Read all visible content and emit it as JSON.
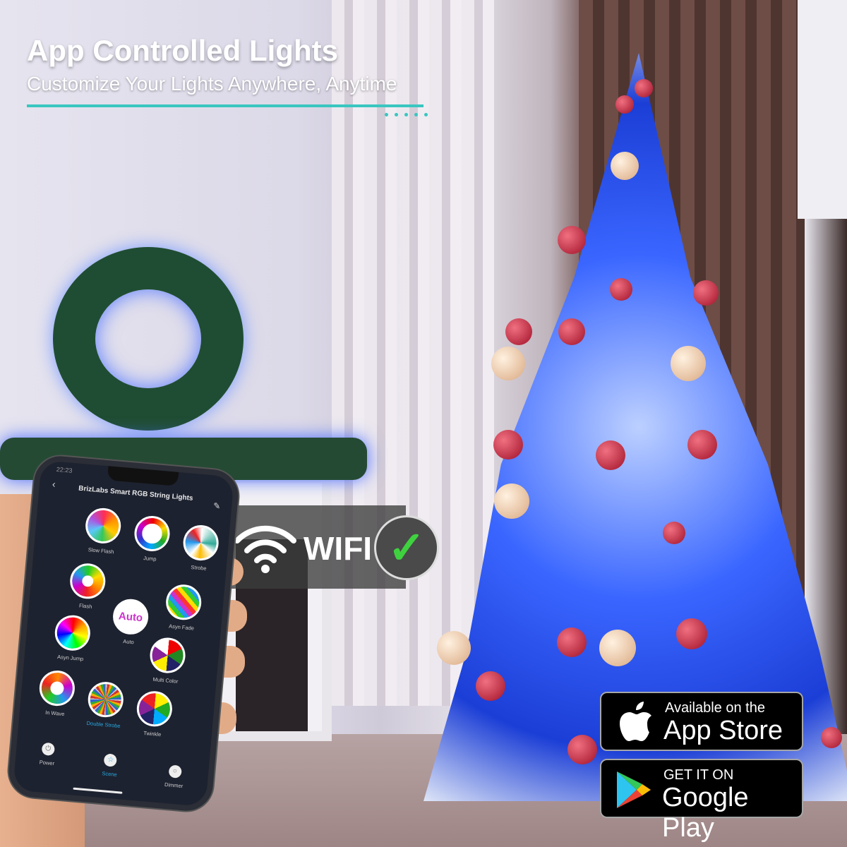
{
  "headline": {
    "title": "App Controlled Lights",
    "subtitle": "Customize Your Lights Anywhere, Anytime",
    "accent": "#39c6c0"
  },
  "wifi_badge": {
    "label": "WIFI",
    "icons": [
      "wifi-icon",
      "checkmark-icon"
    ]
  },
  "phone": {
    "time": "22:23",
    "title": "BrizLabs Smart RGB String Lights",
    "scenes": [
      {
        "label": "Slow Flash"
      },
      {
        "label": "Jump"
      },
      {
        "label": "Strobe"
      },
      {
        "label": "Flash"
      },
      {
        "label": "Auto"
      },
      {
        "label": "Asyn Fade"
      },
      {
        "label": "Asyn Jump"
      },
      {
        "label": "Multi Color"
      },
      {
        "label": "In Wave"
      },
      {
        "label": "Double Strobe",
        "active": true
      },
      {
        "label": "Twinkle"
      }
    ],
    "auto_text": "Auto",
    "nav": [
      {
        "label": "Power"
      },
      {
        "label": "Scene",
        "active": true
      },
      {
        "label": "Dimmer"
      }
    ]
  },
  "stores": {
    "apple": {
      "small": "Available on the",
      "big": "App Store"
    },
    "google": {
      "small": "GET IT ON",
      "big": "Google Play"
    }
  }
}
